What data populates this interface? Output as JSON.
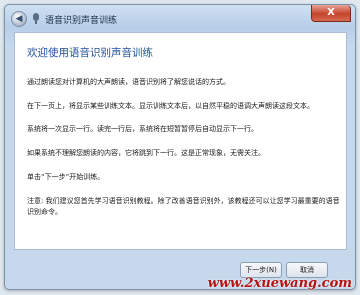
{
  "window": {
    "title": "语音识别声音训练",
    "close_label": "X",
    "back_glyph": "◀"
  },
  "main": {
    "heading": "欢迎使用语音识别声音训练",
    "paragraphs": [
      "通过朗读您对计算机的大声朗读，语音识别将了解您说话的方式。",
      "在下一页上，将显示某些训练文本。显示训练文本后，以自然平稳的语调大声朗读这段文本。",
      "系统将一次显示一行。读完一行后，系统将在短暂暂停后自动显示下一行。",
      "如果系统不理解您朗读的内容，它将跳到下一行。这是正常现象，无需关注。",
      "单击“下一步”开始训练。"
    ],
    "note": "注意: 我们建议您首先学习语音识别教程。除了改善语音识别外，该教程还可以让您学习最重要的语音识别命令。"
  },
  "footer": {
    "next_label": "下一步(N)",
    "cancel_label": "取消"
  },
  "watermark": "www.2xuewang.com"
}
